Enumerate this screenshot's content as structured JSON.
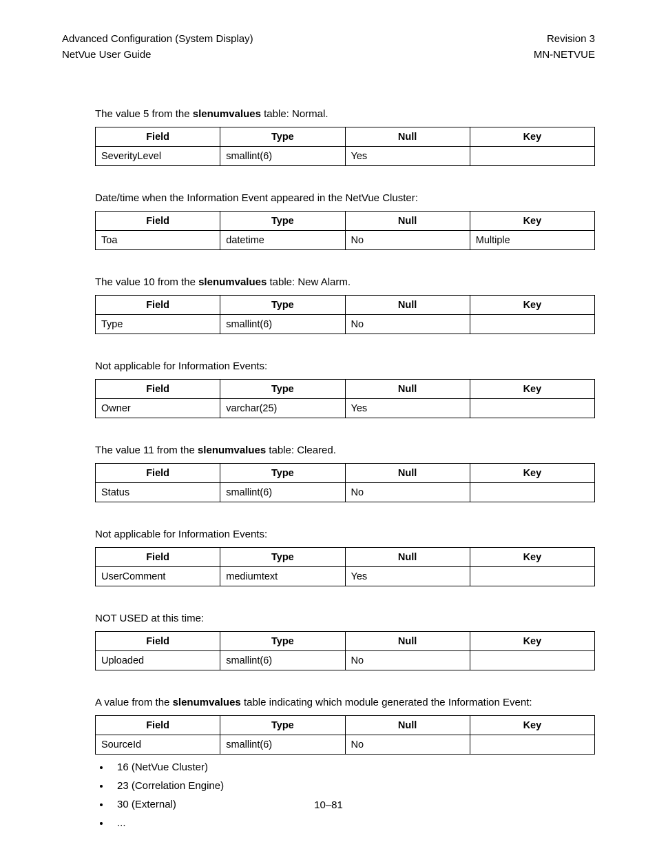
{
  "header": {
    "left1": "Advanced Configuration (System Display)",
    "left2": "NetVue User Guide",
    "right1": "Revision 3",
    "right2": "MN-NETVUE"
  },
  "columns": {
    "field": "Field",
    "type": "Type",
    "null": "Null",
    "key": "Key"
  },
  "sections": [
    {
      "desc_pre": "The value 5 from the ",
      "desc_bold": "slenumvalues",
      "desc_post": " table: Normal.",
      "row": {
        "field": "SeverityLevel",
        "type": "smallint(6)",
        "null": "Yes",
        "key": ""
      }
    },
    {
      "desc_pre": "Date/time when the Information Event appeared in the NetVue Cluster:",
      "desc_bold": "",
      "desc_post": "",
      "row": {
        "field": "Toa",
        "type": "datetime",
        "null": "No",
        "key": "Multiple"
      }
    },
    {
      "desc_pre": "The value 10 from the ",
      "desc_bold": "slenumvalues",
      "desc_post": " table: New Alarm.",
      "row": {
        "field": "Type",
        "type": "smallint(6)",
        "null": "No",
        "key": ""
      }
    },
    {
      "desc_pre": "Not applicable for Information Events:",
      "desc_bold": "",
      "desc_post": "",
      "row": {
        "field": "Owner",
        "type": "varchar(25)",
        "null": "Yes",
        "key": ""
      }
    },
    {
      "desc_pre": "The value 11 from the ",
      "desc_bold": "slenumvalues",
      "desc_post": " table: Cleared.",
      "row": {
        "field": "Status",
        "type": "smallint(6)",
        "null": "No",
        "key": ""
      }
    },
    {
      "desc_pre": "Not applicable for Information Events:",
      "desc_bold": "",
      "desc_post": "",
      "row": {
        "field": "UserComment",
        "type": "mediumtext",
        "null": "Yes",
        "key": ""
      }
    },
    {
      "desc_pre": "NOT USED at this time:",
      "desc_bold": "",
      "desc_post": "",
      "row": {
        "field": "Uploaded",
        "type": "smallint(6)",
        "null": "No",
        "key": ""
      }
    },
    {
      "desc_pre": "A value from the ",
      "desc_bold": "slenumvalues",
      "desc_post": " table indicating which module generated the Information Event:",
      "row": {
        "field": "SourceId",
        "type": "smallint(6)",
        "null": "No",
        "key": ""
      }
    }
  ],
  "bullets": [
    "16 (NetVue Cluster)",
    "23 (Correlation Engine)",
    "30 (External)",
    "..."
  ],
  "pagenum": "10–81"
}
